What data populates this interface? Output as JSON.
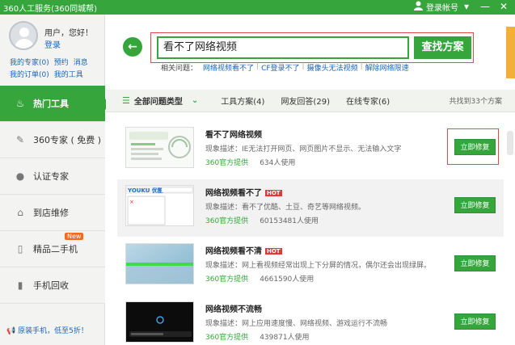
{
  "titlebar": {
    "title": "360人工服务(360同城帮)",
    "login": "登录帐号",
    "controls": [
      "▾",
      "—",
      "✕"
    ]
  },
  "user": {
    "greeting": "用户，您好！",
    "login_link": "登录",
    "links_row1": [
      "我的专家(0)",
      "预约",
      "消息"
    ],
    "links_row2": [
      "我的订单(0)",
      "我的工具"
    ]
  },
  "nav": [
    {
      "label": "热门工具",
      "icon": "fire-icon",
      "glyph": "♨"
    },
    {
      "label": "360专家 ( 免费 )",
      "icon": "chat-icon",
      "glyph": "✎"
    },
    {
      "label": "认证专家",
      "icon": "person-icon",
      "glyph": "●"
    },
    {
      "label": "到店维修",
      "icon": "store-icon",
      "glyph": "⌂"
    },
    {
      "label": "精品二手机",
      "icon": "phone-icon",
      "glyph": "▯",
      "badge": "New"
    },
    {
      "label": "手机回收",
      "icon": "recycle-phone-icon",
      "glyph": "▮"
    }
  ],
  "sidebar_footer": "原装手机，低至5折！",
  "search": {
    "value": "看不了网络视频",
    "button": "查找方案"
  },
  "related": {
    "label": "相关问题：",
    "items": [
      "网络视频看不了",
      "CF登录不了",
      "摄像头无法视频",
      "解除网络限速"
    ]
  },
  "filterbar": {
    "all_types": "全部问题类型",
    "tabs": [
      "工具方案(4)",
      "网友回答(29)",
      "在线专家(6)"
    ],
    "count": "共找到33个方案"
  },
  "results": [
    {
      "title": "看不了网络视频",
      "hot": false,
      "desc": "现象描述：IE无法打开网页、网页图片不显示、无法输入文字",
      "provider": "360官方提供",
      "users": "634人使用",
      "button": "立即修复"
    },
    {
      "title": "网络视频看不了",
      "hot": true,
      "desc": "现象描述：看不了优酷、土豆、奇艺等网络视频。",
      "provider": "360官方提供",
      "users": "60153481人使用",
      "button": "立即修复"
    },
    {
      "title": "网络视频看不清",
      "hot": true,
      "desc": "现象描述：网上看视频经常出现上下分屏的情况，偶尔还会出现绿屏。",
      "provider": "360官方提供",
      "users": "4661590人使用",
      "button": "立即修复"
    },
    {
      "title": "网络视频不流畅",
      "hot": false,
      "desc": "现象描述：网上应用速度慢、网络视频、游戏运行不流畅",
      "provider": "360官方提供",
      "users": "439871人使用",
      "button": "立即修复"
    }
  ],
  "hot_label": "HOT",
  "thumb_youku": "YOUKU 优酷",
  "colors": {
    "brand_green": "#35a53c",
    "highlight_red": "#e24b4b",
    "link_blue": "#1b63b8"
  }
}
